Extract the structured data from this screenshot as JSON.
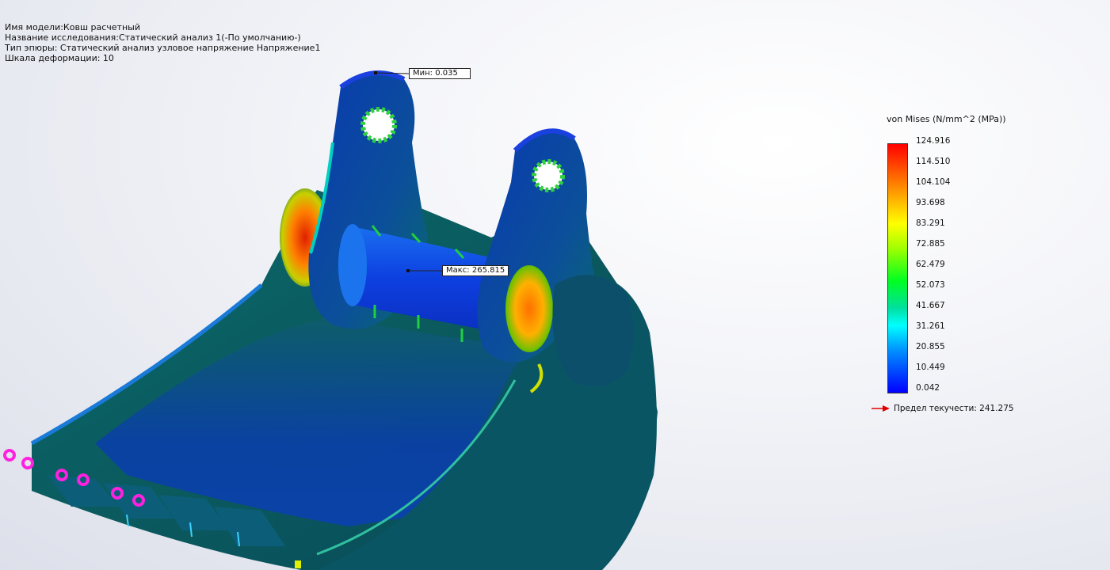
{
  "info": {
    "model_name": "Имя модели:Ковш расчетный",
    "study_name": "Название исследования:Статический анализ 1(-По умолчанию-)",
    "plot_type": "Тип эпюры: Статический анализ узловое напряжение Напряжение1",
    "deformation_scale": "Шкала деформации: 10"
  },
  "callouts": {
    "min_label": "Мин: 0.035",
    "max_label": "Макс: 265.815"
  },
  "legend": {
    "title": "von Mises (N/mm^2 (MPa))",
    "ticks": [
      "124.916",
      "114.510",
      "104.104",
      "93.698",
      "83.291",
      "72.885",
      "62.479",
      "52.073",
      "41.667",
      "31.261",
      "20.855",
      "10.449",
      "0.042"
    ],
    "yield_label": "Предел текучести: 241.275",
    "colors": {
      "max": "#ff0000",
      "high": "#ffb000",
      "mid": "#ffff00",
      "midlow": "#00ff20",
      "low": "#00ffff",
      "min": "#0000ff",
      "yield_arrow": "#e00000"
    }
  }
}
